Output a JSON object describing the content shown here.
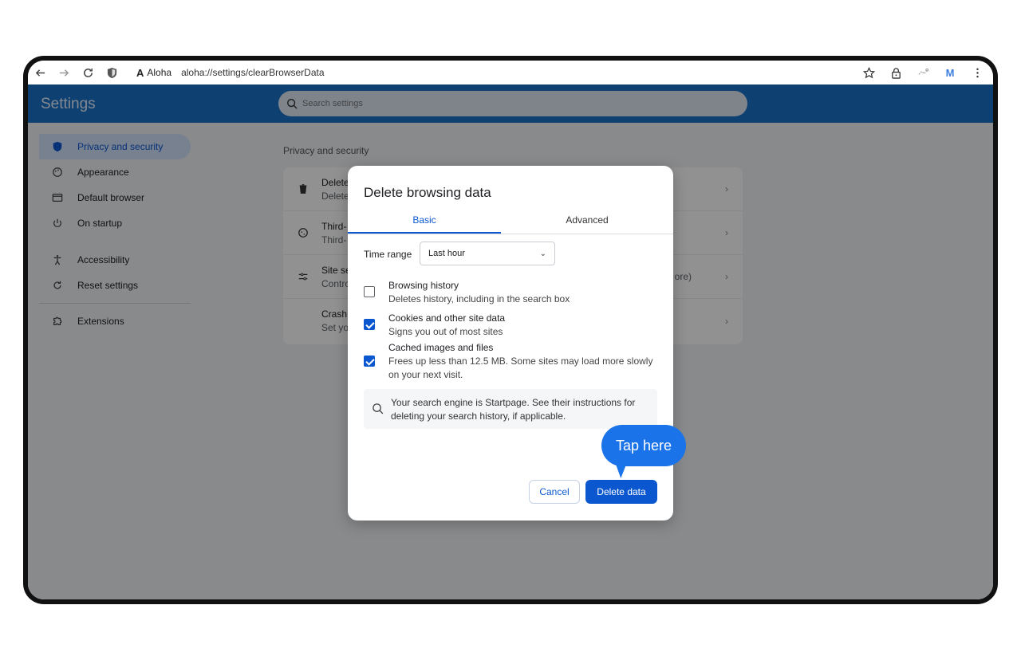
{
  "browser": {
    "site_chip": "Aloha",
    "url": "aloha://settings/clearBrowserData",
    "profile_initial": "M"
  },
  "settings": {
    "header_title": "Settings",
    "search_placeholder": "Search settings",
    "sidebar": [
      {
        "label": "Privacy and security",
        "icon": "shield-icon",
        "active": true
      },
      {
        "label": "Appearance",
        "icon": "palette-icon"
      },
      {
        "label": "Default browser",
        "icon": "browser-window-icon"
      },
      {
        "label": "On startup",
        "icon": "power-icon"
      },
      {
        "label": "Accessibility",
        "icon": "accessibility-icon"
      },
      {
        "label": "Reset settings",
        "icon": "reset-icon"
      },
      {
        "label": "Extensions",
        "icon": "puzzle-icon"
      }
    ],
    "section_title": "Privacy and security",
    "rows": [
      {
        "title": "Delete",
        "subtitle": "Delete",
        "icon": "trash-icon"
      },
      {
        "title": "Third-",
        "subtitle": "Third-",
        "icon": "cookie-icon"
      },
      {
        "title": "Site se",
        "subtitle": "Contro",
        "icon": "tune-icon",
        "extra": "ore)"
      },
      {
        "title": "Crash",
        "subtitle": "Set yo",
        "icon": "none"
      }
    ]
  },
  "dialog": {
    "title": "Delete browsing data",
    "tabs": [
      "Basic",
      "Advanced"
    ],
    "active_tab": "Basic",
    "time_range_label": "Time range",
    "time_range_value": "Last hour",
    "options": [
      {
        "title": "Browsing history",
        "subtitle": "Deletes history, including in the search box",
        "checked": false
      },
      {
        "title": "Cookies and other site data",
        "subtitle": "Signs you out of most sites",
        "checked": true
      },
      {
        "title": "Cached images and files",
        "subtitle": "Frees up less than 12.5 MB. Some sites may load more slowly on your next visit.",
        "checked": true
      }
    ],
    "info_text": "Your search engine is Startpage. See their instructions for deleting your search history, if applicable.",
    "cancel_label": "Cancel",
    "delete_label": "Delete data"
  },
  "callout": {
    "text": "Tap here"
  },
  "colors": {
    "accent": "#0b57d0",
    "header": "#1a73c9",
    "callout": "#1a73e8"
  }
}
